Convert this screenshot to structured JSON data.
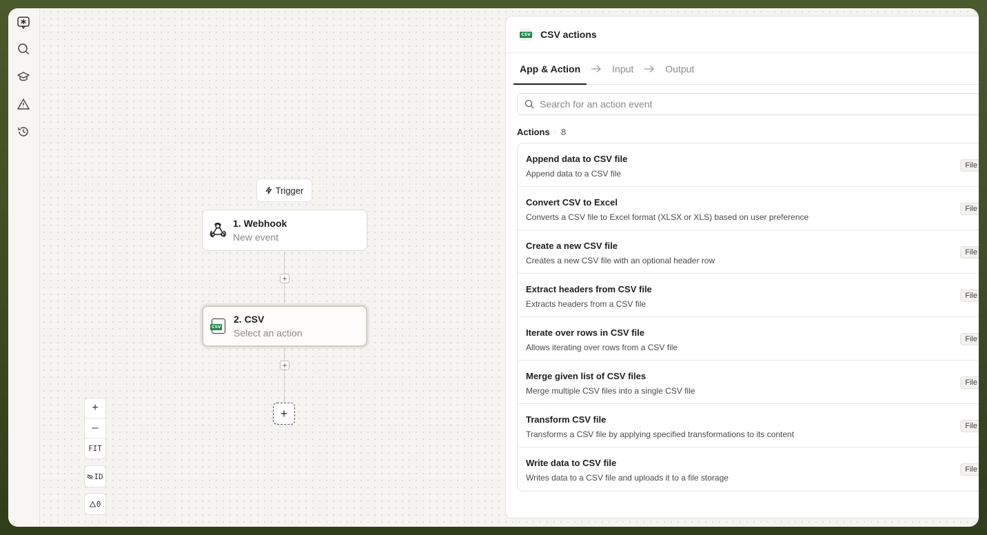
{
  "canvas": {
    "trigger_label": "Trigger",
    "nodes": [
      {
        "title": "1. Webhook",
        "subtitle": "New event"
      },
      {
        "title": "2. CSV",
        "subtitle": "Select an action"
      }
    ],
    "zoom": {
      "zoom_in": "+",
      "zoom_out": "–",
      "fit": "FIT"
    },
    "id_toggle": "ID",
    "warnings_count": "0"
  },
  "csv_tag": "CSV",
  "panel": {
    "title": "CSV actions",
    "tabs": [
      {
        "label": "App & Action"
      },
      {
        "label": "Input"
      },
      {
        "label": "Output"
      }
    ],
    "search": {
      "placeholder": "Search for an action event"
    },
    "actions_label": "Actions",
    "actions_count": "8",
    "actions": [
      {
        "title": "Append data to CSV file",
        "description": "Append data to a CSV file",
        "badge": "File"
      },
      {
        "title": "Convert CSV to Excel",
        "description": "Converts a CSV file to Excel format (XLSX or XLS) based on user preference",
        "badge": "File"
      },
      {
        "title": "Create a new CSV file",
        "description": "Creates a new CSV file with an optional header row",
        "badge": "File"
      },
      {
        "title": "Extract headers from CSV file",
        "description": "Extracts headers from a CSV file",
        "badge": "File"
      },
      {
        "title": "Iterate over rows in CSV file",
        "description": "Allows iterating over rows from a CSV file",
        "badge": "File"
      },
      {
        "title": "Merge given list of CSV files",
        "description": "Merge multiple CSV files into a single CSV file",
        "badge": "File"
      },
      {
        "title": "Transform CSV file",
        "description": "Transforms a CSV file by applying specified transformations to its content",
        "badge": "File"
      },
      {
        "title": "Write data to CSV file",
        "description": "Writes data to a CSV file and uploads it to a file storage",
        "badge": "File"
      }
    ]
  },
  "colors": {
    "accent_csv": "#1e8a46",
    "text_primary": "#1e1e1e",
    "text_muted": "#8b8a86"
  }
}
